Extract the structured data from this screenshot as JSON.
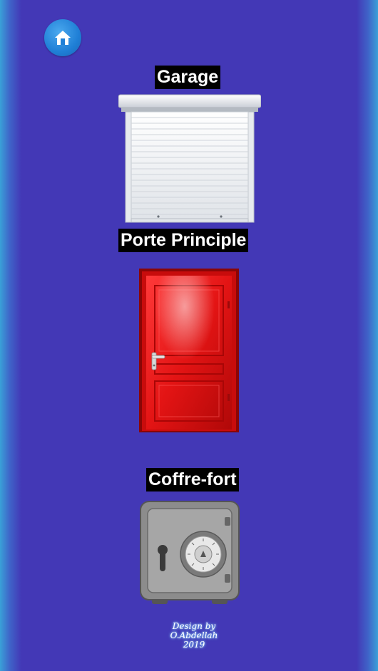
{
  "header": {
    "home_icon": "home-icon",
    "home_color": "#1f7fd6"
  },
  "items": [
    {
      "label": "Garage",
      "icon": "roller-shutter-door"
    },
    {
      "label": "Porte Principle",
      "icon": "red-front-door"
    },
    {
      "label": "Coffre-fort",
      "icon": "safe"
    }
  ],
  "footer": {
    "line1": "Design by",
    "line2": "O.Abdellah",
    "line3": "2019"
  },
  "colors": {
    "background": "#4338b6",
    "edge": "#3aa0d8",
    "label_bg": "#000000",
    "label_text": "#ffffff",
    "door": "#e01a1a"
  }
}
